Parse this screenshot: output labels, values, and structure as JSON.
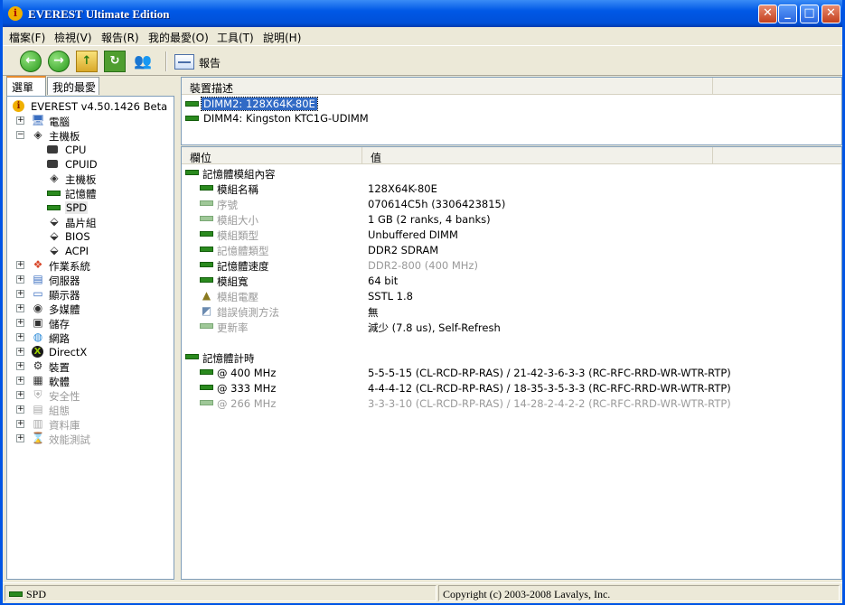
{
  "window": {
    "title": "EVEREST Ultimate Edition",
    "colors": {
      "titlebar": "#0058e6",
      "accent": "#316ac5",
      "close": "#c4401e"
    }
  },
  "menu": [
    "檔案(F)",
    "檢視(V)",
    "報告(R)",
    "我的最愛(O)",
    "工具(T)",
    "說明(H)"
  ],
  "toolbar": {
    "report_label": "報告"
  },
  "left_tabs": [
    "選單",
    "我的最愛"
  ],
  "tree": {
    "root": "EVEREST v4.50.1426 Beta",
    "computer": "電腦",
    "motherboard": "主機板",
    "mb_children": [
      "CPU",
      "CPUID",
      "主機板",
      "記憶體",
      "SPD",
      "晶片組",
      "BIOS",
      "ACPI"
    ],
    "others": [
      "作業系統",
      "伺服器",
      "顯示器",
      "多媒體",
      "儲存",
      "網路",
      "DirectX",
      "裝置",
      "軟體"
    ],
    "disabled": [
      "安全性",
      "組態",
      "資料庫",
      "效能測試"
    ]
  },
  "devices": {
    "header": "裝置描述",
    "items": [
      "DIMM2: 128X64K-80E",
      "DIMM4: Kingston KTC1G-UDIMM"
    ]
  },
  "props": {
    "col_field": "欄位",
    "col_value": "值",
    "section1": "記憶體模組內容",
    "rows1": [
      {
        "field": "模組名稱",
        "value": "128X64K-80E"
      },
      {
        "field": "序號",
        "value": "070614C5h (3306423815)"
      },
      {
        "field": "模組大小",
        "value": "1 GB (2 ranks, 4 banks)"
      },
      {
        "field": "模組類型",
        "value": "Unbuffered DIMM"
      },
      {
        "field": "記憶體類型",
        "value": "DDR2 SDRAM"
      },
      {
        "field": "記憶體速度",
        "value": "DDR2-800 (400 MHz)"
      },
      {
        "field": "模組寬",
        "value": "64 bit"
      },
      {
        "field": "模組電壓",
        "value": "SSTL 1.8"
      },
      {
        "field": "錯誤偵測方法",
        "value": "無"
      },
      {
        "field": "更新率",
        "value": "減少 (7.8 us), Self-Refresh"
      }
    ],
    "section2": "記憶體計時",
    "rows2": [
      {
        "field": "@ 400 MHz",
        "value": "5-5-5-15  (CL-RCD-RP-RAS) / 21-42-3-6-3-3  (RC-RFC-RRD-WR-WTR-RTP)"
      },
      {
        "field": "@ 333 MHz",
        "value": "4-4-4-12  (CL-RCD-RP-RAS) / 18-35-3-5-3-3  (RC-RFC-RRD-WR-WTR-RTP)"
      },
      {
        "field": "@ 266 MHz",
        "value": "3-3-3-10  (CL-RCD-RP-RAS) / 14-28-2-4-2-2  (RC-RFC-RRD-WR-WTR-RTP)"
      }
    ]
  },
  "status": {
    "left": "SPD",
    "right": "Copyright (c) 2003-2008 Lavalys, Inc."
  }
}
